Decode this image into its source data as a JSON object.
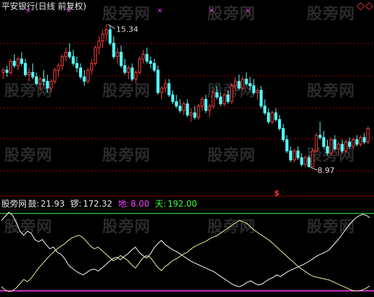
{
  "header": {
    "title": "平安银行(日线 前复权)",
    "title_color": "#e6e6e6"
  },
  "watermark": {
    "text": "股旁网"
  },
  "price_panel": {
    "high_label": "15.34",
    "low_label": "8.97",
    "signal_glyph": "$",
    "colors": {
      "up": "#ff3c3c",
      "down": "#54ffff",
      "grid": "#a50000",
      "label": "#dcdcdc",
      "marker": "#ff40ff",
      "signal": "#ff3030"
    }
  },
  "indicator_panel": {
    "name": "股旁网",
    "items": [
      {
        "label": "鼓:",
        "value": "21.93",
        "color": "#e6e6e6"
      },
      {
        "label": "锣:",
        "value": "172.32",
        "color": "#e6e6e6"
      },
      {
        "label": "地:",
        "value": "8.00",
        "color": "#ff40ff"
      },
      {
        "label": "天:",
        "value": "192.00",
        "color": "#40ff40"
      }
    ],
    "colors": {
      "drum_line": "#ffffff",
      "gong_line": "#f0f0a0",
      "earth_line": "#ff40ff",
      "sky_line": "#40ff40"
    }
  },
  "chart_data": [
    {
      "type": "candlestick",
      "title": "平安银行(日线 前复权)",
      "ylim": [
        8.0,
        15.8
      ],
      "annotations": [
        {
          "text": "15.34",
          "at": "max",
          "value": 15.34
        },
        {
          "text": "8.97",
          "at": "min",
          "value": 8.97
        }
      ],
      "candles_ohlc": [
        [
          13.2,
          13.4,
          12.9,
          13.3
        ],
        [
          13.3,
          13.5,
          13.0,
          13.2
        ],
        [
          13.2,
          13.8,
          13.1,
          13.7
        ],
        [
          13.7,
          14.0,
          13.4,
          13.5
        ],
        [
          13.5,
          13.9,
          13.3,
          13.8
        ],
        [
          13.8,
          14.1,
          13.5,
          13.6
        ],
        [
          13.6,
          13.8,
          13.0,
          13.1
        ],
        [
          13.1,
          13.4,
          12.8,
          13.2
        ],
        [
          13.2,
          13.6,
          12.9,
          13.0
        ],
        [
          13.0,
          13.2,
          12.6,
          12.7
        ],
        [
          12.7,
          13.0,
          12.4,
          12.9
        ],
        [
          12.9,
          13.3,
          12.6,
          12.8
        ],
        [
          12.8,
          13.1,
          12.3,
          12.5
        ],
        [
          12.5,
          12.9,
          12.3,
          12.8
        ],
        [
          12.8,
          13.4,
          12.7,
          13.3
        ],
        [
          13.3,
          13.6,
          13.0,
          13.5
        ],
        [
          13.5,
          14.0,
          13.3,
          13.9
        ],
        [
          13.9,
          14.3,
          13.7,
          14.1
        ],
        [
          14.1,
          14.5,
          13.8,
          13.9
        ],
        [
          13.9,
          14.2,
          13.5,
          13.6
        ],
        [
          13.6,
          13.9,
          13.2,
          13.4
        ],
        [
          13.4,
          13.6,
          12.9,
          13.0
        ],
        [
          13.0,
          13.3,
          12.6,
          12.8
        ],
        [
          12.8,
          13.4,
          12.7,
          13.3
        ],
        [
          13.3,
          13.8,
          13.1,
          13.6
        ],
        [
          13.6,
          14.4,
          13.5,
          14.3
        ],
        [
          14.3,
          14.8,
          14.0,
          14.6
        ],
        [
          14.6,
          15.1,
          14.3,
          14.9
        ],
        [
          14.9,
          15.34,
          14.6,
          15.1
        ],
        [
          15.1,
          15.3,
          14.4,
          14.5
        ],
        [
          14.5,
          14.8,
          13.8,
          13.9
        ],
        [
          13.9,
          14.3,
          13.6,
          14.1
        ],
        [
          14.1,
          14.4,
          13.4,
          13.5
        ],
        [
          13.5,
          13.8,
          13.1,
          13.2
        ],
        [
          13.2,
          13.5,
          12.9,
          13.4
        ],
        [
          13.4,
          13.6,
          12.8,
          12.9
        ],
        [
          12.9,
          13.3,
          12.7,
          13.2
        ],
        [
          13.2,
          13.9,
          13.1,
          13.8
        ],
        [
          13.8,
          14.2,
          13.6,
          14.0
        ],
        [
          14.0,
          14.3,
          13.6,
          13.7
        ],
        [
          13.7,
          13.9,
          13.4,
          13.6
        ],
        [
          13.6,
          13.8,
          13.2,
          13.3
        ],
        [
          13.3,
          13.5,
          12.2,
          12.3
        ],
        [
          12.3,
          12.6,
          12.0,
          12.5
        ],
        [
          12.5,
          12.9,
          12.3,
          12.7
        ],
        [
          12.7,
          12.9,
          12.1,
          12.2
        ],
        [
          12.2,
          12.4,
          11.8,
          11.9
        ],
        [
          11.9,
          12.2,
          11.6,
          11.7
        ],
        [
          11.7,
          12.0,
          11.4,
          11.5
        ],
        [
          11.5,
          11.9,
          11.3,
          11.8
        ],
        [
          11.8,
          12.0,
          11.2,
          11.3
        ],
        [
          11.3,
          11.6,
          11.0,
          11.4
        ],
        [
          11.4,
          11.7,
          11.1,
          11.2
        ],
        [
          11.2,
          11.8,
          11.1,
          11.7
        ],
        [
          11.7,
          12.1,
          11.5,
          12.0
        ],
        [
          12.0,
          12.2,
          11.4,
          11.5
        ],
        [
          11.5,
          11.8,
          11.2,
          11.7
        ],
        [
          11.7,
          12.4,
          11.6,
          12.3
        ],
        [
          12.3,
          12.6,
          12.0,
          12.1
        ],
        [
          12.1,
          12.3,
          11.7,
          11.8
        ],
        [
          11.8,
          12.3,
          11.7,
          12.2
        ],
        [
          12.2,
          12.4,
          11.8,
          11.9
        ],
        [
          11.9,
          12.7,
          11.8,
          12.6
        ],
        [
          12.6,
          13.0,
          12.4,
          12.8
        ],
        [
          12.8,
          13.1,
          12.4,
          12.5
        ],
        [
          12.5,
          13.0,
          12.4,
          12.9
        ],
        [
          12.9,
          13.2,
          12.6,
          12.7
        ],
        [
          12.7,
          13.0,
          12.4,
          12.6
        ],
        [
          12.6,
          12.9,
          12.2,
          12.3
        ],
        [
          12.3,
          12.5,
          12.0,
          12.4
        ],
        [
          12.4,
          12.6,
          11.6,
          11.7
        ],
        [
          11.7,
          12.0,
          11.3,
          11.4
        ],
        [
          11.4,
          11.6,
          10.9,
          11.0
        ],
        [
          11.0,
          11.5,
          10.9,
          11.4
        ],
        [
          11.4,
          11.6,
          11.0,
          11.1
        ],
        [
          11.1,
          11.3,
          10.6,
          10.7
        ],
        [
          10.7,
          10.9,
          10.1,
          10.2
        ],
        [
          10.2,
          10.4,
          9.6,
          9.7
        ],
        [
          9.7,
          9.9,
          9.2,
          9.3
        ],
        [
          9.3,
          9.8,
          9.2,
          9.7
        ],
        [
          9.7,
          9.9,
          9.3,
          9.4
        ],
        [
          9.4,
          9.6,
          9.0,
          9.1
        ],
        [
          9.1,
          9.5,
          9.0,
          9.4
        ],
        [
          9.4,
          9.5,
          8.97,
          9.0
        ],
        [
          9.0,
          9.8,
          8.98,
          9.7
        ],
        [
          9.7,
          10.5,
          9.6,
          10.4
        ],
        [
          10.4,
          11.0,
          10.2,
          10.3
        ],
        [
          10.3,
          10.6,
          9.8,
          9.9
        ],
        [
          9.9,
          10.2,
          9.5,
          9.6
        ],
        [
          9.6,
          10.3,
          9.5,
          10.2
        ],
        [
          10.2,
          10.4,
          9.7,
          9.8
        ],
        [
          9.8,
          10.1,
          9.5,
          10.0
        ],
        [
          10.0,
          10.2,
          9.6,
          9.7
        ],
        [
          9.7,
          10.2,
          9.6,
          10.1
        ],
        [
          10.1,
          10.3,
          9.8,
          9.9
        ],
        [
          9.9,
          10.3,
          9.8,
          10.2
        ],
        [
          10.2,
          10.4,
          9.9,
          10.0
        ],
        [
          10.0,
          10.4,
          9.9,
          10.3
        ],
        [
          10.3,
          10.5,
          10.0,
          10.1
        ],
        [
          10.1,
          10.8,
          10.0,
          10.7
        ]
      ]
    },
    {
      "type": "line",
      "title": "股旁网",
      "ylim": [
        0,
        200
      ],
      "series": [
        {
          "name": "鼓",
          "values": [
            175,
            185,
            195,
            188,
            170,
            150,
            140,
            150,
            145,
            130,
            125,
            130,
            118,
            108,
            112,
            100,
            95,
            85,
            70,
            62,
            55,
            50,
            46,
            52,
            58,
            60,
            55,
            62,
            70,
            78,
            85,
            88,
            82,
            90,
            96,
            105,
            112,
            100,
            92,
            86,
            95,
            110,
            120,
            128,
            118,
            112,
            106,
            102,
            96,
            90,
            84,
            78,
            74,
            70,
            66,
            62,
            58,
            54,
            48,
            42,
            36,
            30,
            24,
            20,
            18,
            22,
            28,
            32,
            26,
            22,
            24,
            30,
            36,
            40,
            46,
            42,
            48,
            54,
            58,
            62,
            66,
            70,
            75,
            80,
            86,
            92,
            96,
            100,
            105,
            115,
            125,
            135,
            148,
            160,
            170,
            180,
            186,
            190,
            188,
            182
          ]
        },
        {
          "name": "锣",
          "values": [
            18,
            10,
            6,
            8,
            15,
            25,
            35,
            30,
            38,
            50,
            62,
            72,
            82,
            92,
            100,
            108,
            114,
            120,
            128,
            134,
            138,
            140,
            134,
            124,
            114,
            108,
            112,
            104,
            96,
            88,
            80,
            84,
            92,
            86,
            80,
            70,
            62,
            74,
            86,
            92,
            88,
            76,
            64,
            56,
            66,
            72,
            80,
            84,
            90,
            96,
            100,
            108,
            114,
            118,
            122,
            126,
            132,
            136,
            140,
            146,
            152,
            158,
            164,
            170,
            176,
            172,
            168,
            160,
            152,
            146,
            140,
            134,
            128,
            120,
            112,
            104,
            96,
            88,
            80,
            72,
            64,
            58,
            52,
            46,
            42,
            40,
            38,
            36,
            34,
            30,
            26,
            22,
            18,
            14,
            10,
            8,
            8,
            10,
            14,
            20
          ]
        },
        {
          "name": "地",
          "values": [
            8
          ]
        },
        {
          "name": "天",
          "values": [
            192
          ]
        }
      ]
    }
  ]
}
